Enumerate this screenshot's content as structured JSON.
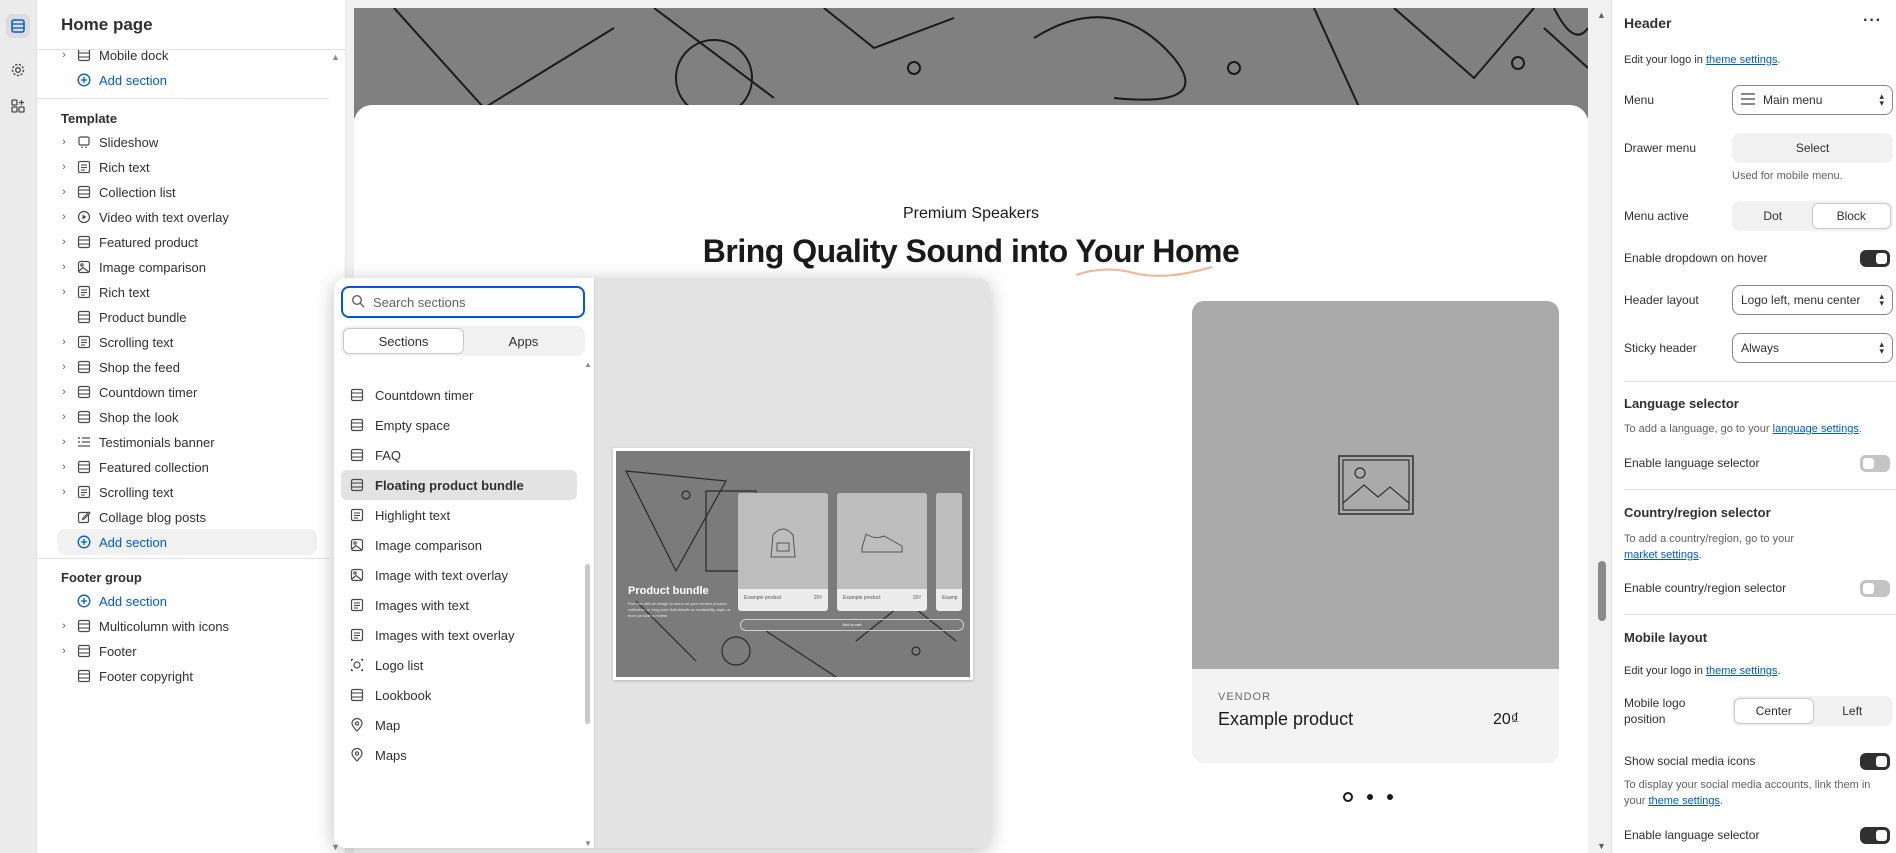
{
  "sidebar": {
    "title": "Home page",
    "header_items": [
      {
        "label": "Mobile dock",
        "icon": "section-icon",
        "chevron": true
      }
    ],
    "add_section_label": "Add section",
    "template_group": "Template",
    "template_items": [
      {
        "label": "Slideshow",
        "icon": "slideshow-icon",
        "chevron": true
      },
      {
        "label": "Rich text",
        "icon": "text-icon",
        "chevron": true
      },
      {
        "label": "Collection list",
        "icon": "section-icon",
        "chevron": true
      },
      {
        "label": "Video with text overlay",
        "icon": "play-icon",
        "chevron": true
      },
      {
        "label": "Featured product",
        "icon": "section-icon",
        "chevron": true
      },
      {
        "label": "Image comparison",
        "icon": "image-icon",
        "chevron": true
      },
      {
        "label": "Rich text",
        "icon": "text-icon",
        "chevron": true
      },
      {
        "label": "Product bundle",
        "icon": "section-icon",
        "chevron": false
      },
      {
        "label": "Scrolling text",
        "icon": "text-icon",
        "chevron": true
      },
      {
        "label": "Shop the feed",
        "icon": "section-icon",
        "chevron": true
      },
      {
        "label": "Countdown timer",
        "icon": "section-icon",
        "chevron": true
      },
      {
        "label": "Shop the look",
        "icon": "section-icon",
        "chevron": true
      },
      {
        "label": "Testimonials banner",
        "icon": "list-icon",
        "chevron": true
      },
      {
        "label": "Featured collection",
        "icon": "section-icon",
        "chevron": true
      },
      {
        "label": "Scrolling text",
        "icon": "text-icon",
        "chevron": true
      },
      {
        "label": "Collage blog posts",
        "icon": "edit-icon",
        "chevron": false
      }
    ],
    "footer_group": "Footer group",
    "footer_items": [
      {
        "label": "Multicolumn with icons",
        "icon": "section-icon",
        "chevron": true
      },
      {
        "label": "Footer",
        "icon": "section-icon",
        "chevron": true
      },
      {
        "label": "Footer copyright",
        "icon": "section-icon",
        "chevron": false
      }
    ]
  },
  "preview": {
    "eyebrow": "Premium Speakers",
    "headline": "Bring Quality Sound into Your Home",
    "product": {
      "vendor": "VENDOR",
      "name": "Example product",
      "price": "20₫"
    }
  },
  "picker": {
    "search_placeholder": "Search sections",
    "tabs": [
      "Sections",
      "Apps"
    ],
    "active_tab": "Sections",
    "items": [
      {
        "label": "Countdown timer",
        "icon": "section-icon"
      },
      {
        "label": "Empty space",
        "icon": "section-icon"
      },
      {
        "label": "FAQ",
        "icon": "section-icon"
      },
      {
        "label": "Floating product bundle",
        "icon": "section-icon"
      },
      {
        "label": "Highlight text",
        "icon": "text-icon"
      },
      {
        "label": "Image comparison",
        "icon": "image-icon"
      },
      {
        "label": "Image with text overlay",
        "icon": "image-icon"
      },
      {
        "label": "Images with text",
        "icon": "text-icon"
      },
      {
        "label": "Images with text overlay",
        "icon": "text-icon"
      },
      {
        "label": "Logo list",
        "icon": "logo-icon"
      },
      {
        "label": "Lookbook",
        "icon": "section-icon"
      },
      {
        "label": "Map",
        "icon": "map-pin-icon"
      },
      {
        "label": "Maps",
        "icon": "map-pin-icon"
      }
    ],
    "hovered_item": "Floating product bundle",
    "preview": {
      "title": "Product bundle",
      "description": "Pair text with an image to focus on your chosen product, collection, or blog post. Add details on availability, style, or even provide a review.",
      "cards": [
        {
          "label": "Example product",
          "price": "20₫"
        },
        {
          "label": "Example product",
          "price": "20₫"
        },
        {
          "label": "Examp",
          "price": ""
        }
      ],
      "button_label": "Add to cart"
    }
  },
  "settings": {
    "title": "Header",
    "logo_text": "Edit your logo in ",
    "logo_link": "theme settings",
    "menu_label": "Menu",
    "menu_value": "Main menu",
    "drawer_label": "Drawer menu",
    "drawer_button": "Select",
    "drawer_help": "Used for mobile menu.",
    "menu_active_label": "Menu active",
    "menu_active_options": [
      "Dot",
      "Block"
    ],
    "menu_active_value": "Block",
    "dropdown_hover_label": "Enable dropdown on hover",
    "dropdown_hover_on": true,
    "header_layout_label": "Header layout",
    "header_layout_value": "Logo left, menu center",
    "sticky_label": "Sticky header",
    "sticky_value": "Always",
    "language_section": "Language selector",
    "language_help": "To add a language, go to your ",
    "language_link": "language settings",
    "language_enable_label": "Enable language selector",
    "language_enable_on": false,
    "country_section": "Country/region selector",
    "country_help": "To add a country/region, go to your ",
    "country_link": "market settings",
    "country_enable_label": "Enable country/region selector",
    "country_enable_on": false,
    "mobile_section": "Mobile layout",
    "mobile_logo_text": "Edit your logo in ",
    "mobile_logo_link": "theme settings",
    "mobile_logo_pos_label": "Mobile logo position",
    "mobile_logo_pos_options": [
      "Center",
      "Left"
    ],
    "mobile_logo_pos_value": "Center",
    "social_label": "Show social media icons",
    "social_on": true,
    "social_help": "To display your social media accounts, link them in your ",
    "social_link": "theme settings",
    "mobile_language_label": "Enable language selector",
    "mobile_language_on": true
  },
  "colors": {
    "accent": "#005bd3",
    "toggle_on": "#303030",
    "placeholder_gray": "#808080"
  }
}
